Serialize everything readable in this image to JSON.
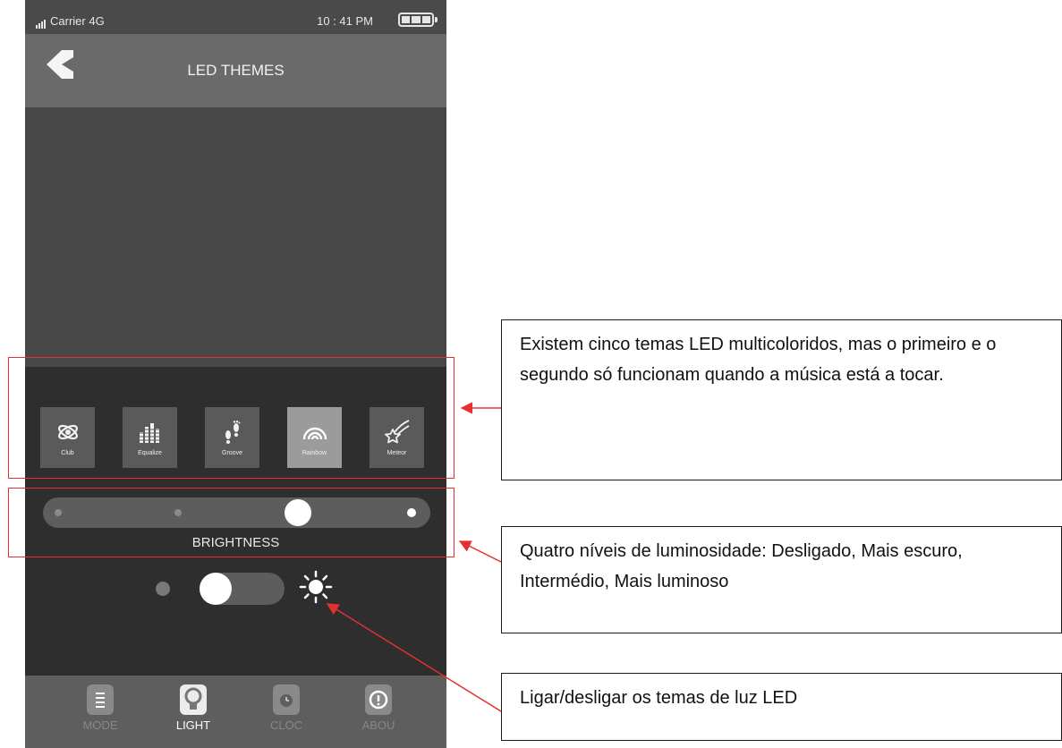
{
  "status_bar": {
    "carrier": "Carrier  4G",
    "time": "10 : 41 PM"
  },
  "header": {
    "title": "LED THEMES"
  },
  "themes": [
    {
      "label": "Club",
      "icon": "club-icon"
    },
    {
      "label": "Equalize",
      "icon": "equalizer-icon"
    },
    {
      "label": "Groove",
      "icon": "footprints-icon"
    },
    {
      "label": "Rainbow",
      "icon": "rainbow-icon",
      "selected": true
    },
    {
      "label": "Meteor",
      "icon": "meteor-icon"
    }
  ],
  "brightness": {
    "label": "BRIGHTNESS",
    "levels": 4,
    "selected_level": 3
  },
  "led_toggle": {
    "on": false,
    "icon": "sun-icon"
  },
  "tabs": [
    {
      "label": "MODE",
      "icon": "mode-icon"
    },
    {
      "label": "LIGHT",
      "icon": "bulb-icon",
      "active": true
    },
    {
      "label": "CLOC",
      "icon": "clock-icon"
    },
    {
      "label": "ABOU",
      "icon": "info-icon"
    }
  ],
  "callouts": {
    "themes": "Existem cinco temas LED multicoloridos, mas o primeiro e o segundo só funcionam quando a música está a tocar.",
    "brightness": "Quatro níveis de luminosidade: Desligado, Mais escuro, Intermédio, Mais luminoso",
    "toggle": "Ligar/desligar os temas de luz LED"
  },
  "colors": {
    "annotation_red": "#e53030",
    "selected_theme": "#9b9b9b"
  }
}
